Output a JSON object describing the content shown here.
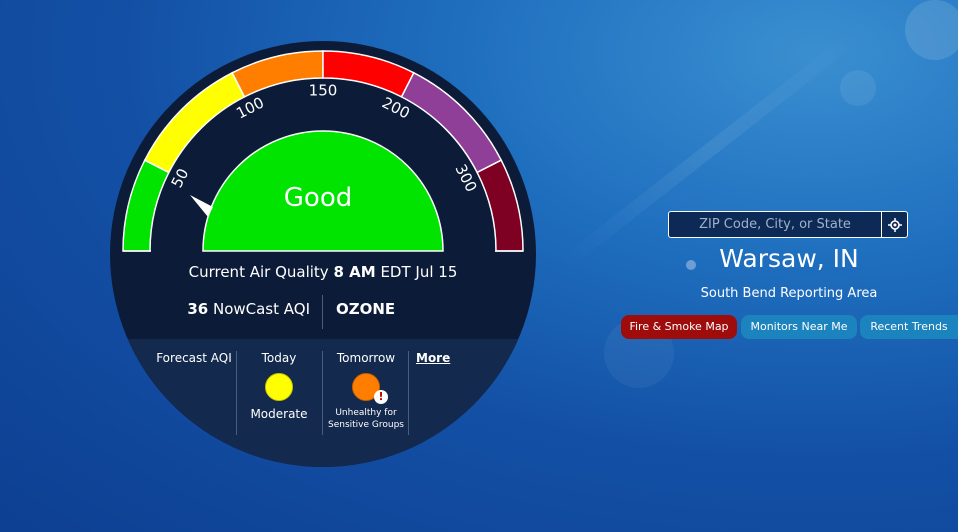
{
  "gauge": {
    "category": "Good",
    "tick_labels": [
      "50",
      "100",
      "150",
      "200",
      "300"
    ],
    "colors": {
      "good": "#00e400",
      "moderate": "#ffff00",
      "usg": "#ff7e00",
      "unhealthy": "#ff0000",
      "very_unhealthy": "#8f3f97",
      "hazardous": "#7e0023"
    }
  },
  "current": {
    "prefix": "Current Air Quality",
    "time": "8 AM",
    "suffix": "EDT Jul 15",
    "aqi_value": "36",
    "aqi_label": "NowCast AQI",
    "pollutant": "OZONE"
  },
  "forecast": {
    "label": "Forecast AQI",
    "today": {
      "day": "Today",
      "category": "Moderate",
      "color": "#ffff00"
    },
    "tomorrow": {
      "day": "Tomorrow",
      "category": "Unhealthy for Sensitive Groups",
      "color": "#ff7e00",
      "alert_icon": "alert-icon"
    },
    "more_label": "More"
  },
  "location": {
    "search_placeholder": "ZIP Code, City, or State",
    "locate_icon": "locate-icon",
    "city": "Warsaw, IN",
    "reporting_area": "South Bend Reporting Area"
  },
  "buttons": {
    "fire_smoke": "Fire & Smoke Map",
    "monitors": "Monitors Near Me",
    "trends": "Recent Trends"
  }
}
